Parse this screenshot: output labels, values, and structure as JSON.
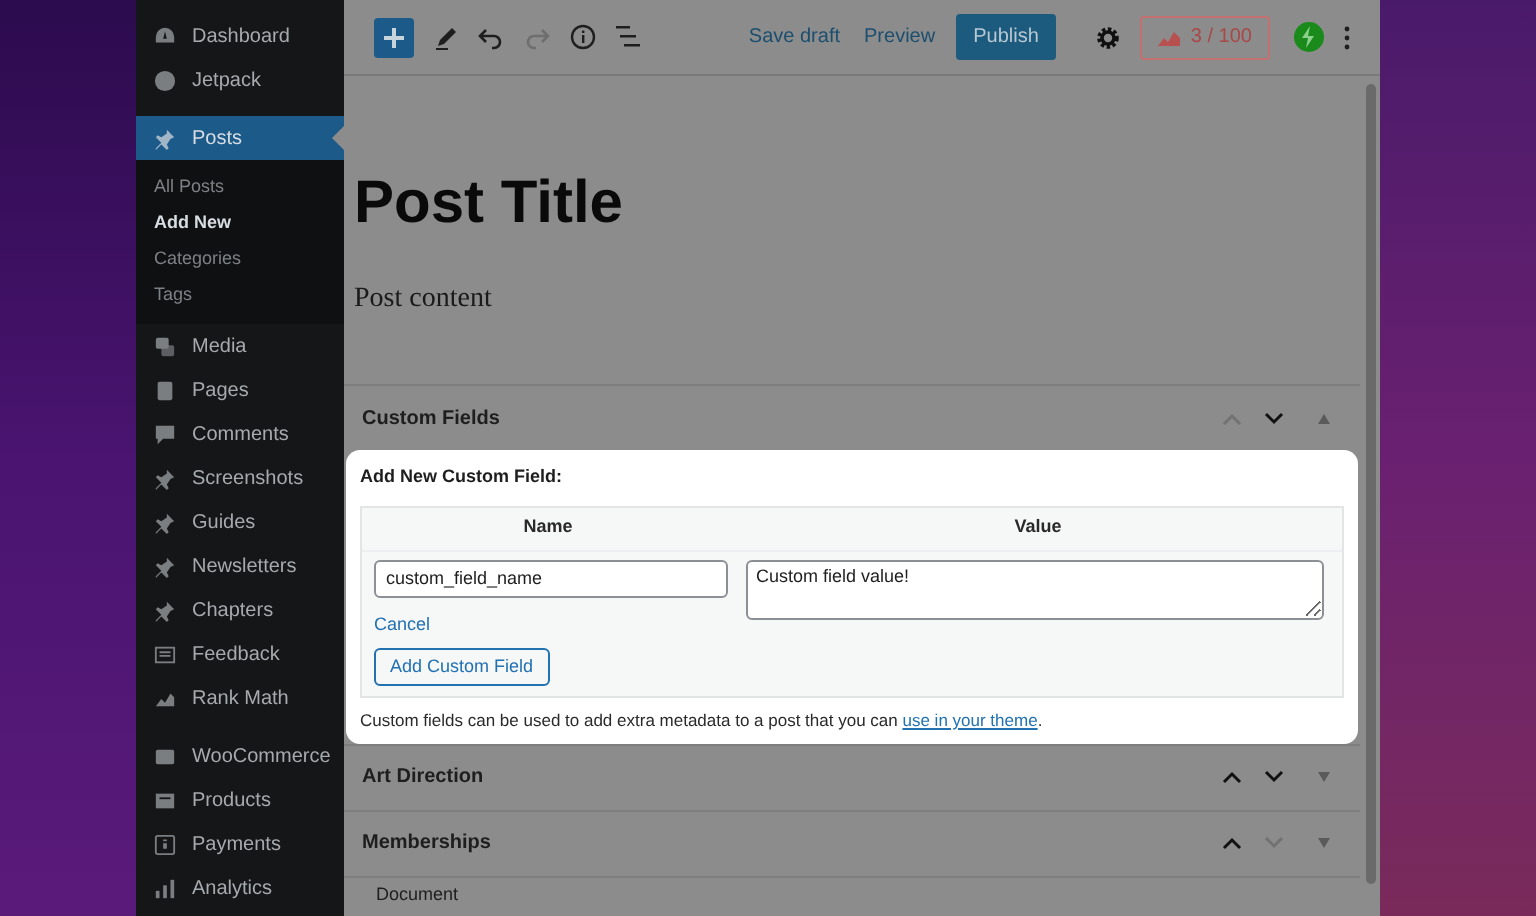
{
  "sidebar": {
    "groups": [
      [
        {
          "label": "Dashboard",
          "selected": false
        },
        {
          "label": "Jetpack",
          "selected": false
        }
      ],
      [
        {
          "label": "Posts",
          "selected": true,
          "children": [
            {
              "label": "All Posts",
              "selected": false
            },
            {
              "label": "Add New",
              "selected": true
            },
            {
              "label": "Categories",
              "selected": false
            },
            {
              "label": "Tags",
              "selected": false
            }
          ]
        },
        {
          "label": "Media",
          "selected": false
        },
        {
          "label": "Pages",
          "selected": false
        },
        {
          "label": "Comments",
          "selected": false
        },
        {
          "label": "Screenshots",
          "selected": false
        },
        {
          "label": "Guides",
          "selected": false
        },
        {
          "label": "Newsletters",
          "selected": false
        },
        {
          "label": "Chapters",
          "selected": false
        },
        {
          "label": "Feedback",
          "selected": false
        },
        {
          "label": "Rank Math",
          "selected": false
        }
      ],
      [
        {
          "label": "WooCommerce",
          "selected": false
        },
        {
          "label": "Products",
          "selected": false
        },
        {
          "label": "Payments",
          "selected": false
        },
        {
          "label": "Analytics",
          "selected": false
        }
      ]
    ]
  },
  "toolbar": {
    "undo_disabled": false,
    "redo_disabled": true,
    "save_draft": "Save draft",
    "preview": "Preview",
    "publish": "Publish",
    "score": "3 / 100"
  },
  "post": {
    "title": "Post Title",
    "content": "Post content"
  },
  "panels": [
    {
      "title": "Custom Fields",
      "up_disabled": true,
      "down_disabled": false,
      "expanded": true
    },
    {
      "title": "Art Direction",
      "up_disabled": false,
      "down_disabled": false,
      "expanded": false
    },
    {
      "title": "Memberships",
      "up_disabled": false,
      "down_disabled": true,
      "expanded": false
    }
  ],
  "custom_field_form": {
    "heading": "Add New Custom Field:",
    "columns": [
      "Name",
      "Value"
    ],
    "name_value": "custom_field_name",
    "value_value": "Custom field value!",
    "cancel": "Cancel",
    "add_button": "Add Custom Field",
    "note": "Custom fields can be used to add extra metadata to a post that you can ",
    "note_link": "use in your theme",
    "note_end": "."
  },
  "document_tab": "Document"
}
